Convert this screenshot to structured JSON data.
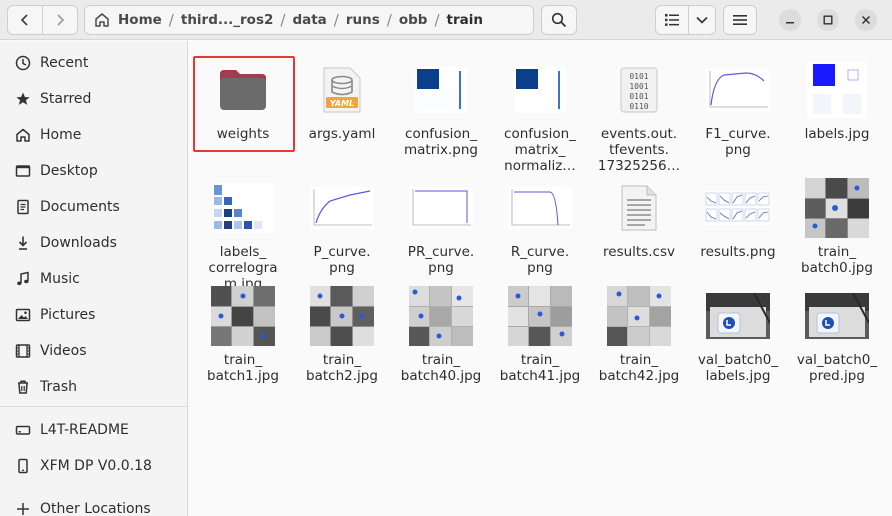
{
  "header": {
    "breadcrumbs": [
      "Home",
      "third..._ros2",
      "data",
      "runs",
      "obb",
      "train"
    ],
    "separator": "/"
  },
  "icons": {
    "back": "chevron-left-icon",
    "forward": "chevron-right-icon",
    "home": "home-icon",
    "path_menu": "vertical-dots-icon",
    "search": "search-icon",
    "view": "list-view-icon",
    "view_dropdown": "chevron-down-icon",
    "menu": "hamburger-menu-icon",
    "minimize": "minimize-icon",
    "maximize": "maximize-icon",
    "close": "close-icon"
  },
  "sidebar": {
    "items": [
      {
        "label": "Recent",
        "icon": "clock-icon"
      },
      {
        "label": "Starred",
        "icon": "star-icon"
      },
      {
        "label": "Home",
        "icon": "home-icon"
      },
      {
        "label": "Desktop",
        "icon": "desktop-icon"
      },
      {
        "label": "Documents",
        "icon": "document-icon"
      },
      {
        "label": "Downloads",
        "icon": "download-icon"
      },
      {
        "label": "Music",
        "icon": "music-icon"
      },
      {
        "label": "Pictures",
        "icon": "pictures-icon"
      },
      {
        "label": "Videos",
        "icon": "video-icon"
      },
      {
        "label": "Trash",
        "icon": "trash-icon"
      }
    ],
    "devices": [
      {
        "label": "L4T-README",
        "icon": "drive-icon"
      },
      {
        "label": "XFM DP V0.0.18",
        "icon": "phone-icon"
      },
      {
        "label": "Other Locations",
        "icon": "plus-icon"
      }
    ]
  },
  "files": [
    {
      "name": "weights",
      "kind": "folder"
    },
    {
      "name": "args.yaml",
      "kind": "yaml"
    },
    {
      "name": "confusion_\nmatrix.png",
      "kind": "matrix"
    },
    {
      "name": "confusion_\nmatrix_\nnormaliz…",
      "kind": "matrix"
    },
    {
      "name": "events.out.\ntfevents.\n17325256…",
      "kind": "binary"
    },
    {
      "name": "F1_curve.\npng",
      "kind": "curve"
    },
    {
      "name": "labels.jpg",
      "kind": "labels"
    },
    {
      "name": "labels_\ncorrelogra\nm.jpg",
      "kind": "correlogram"
    },
    {
      "name": "P_curve.\npng",
      "kind": "curve"
    },
    {
      "name": "PR_curve.\npng",
      "kind": "flatcurve"
    },
    {
      "name": "R_curve.\npng",
      "kind": "flatcurve"
    },
    {
      "name": "results.csv",
      "kind": "text"
    },
    {
      "name": "results.png",
      "kind": "results"
    },
    {
      "name": "train_\nbatch0.jpg",
      "kind": "photo"
    },
    {
      "name": "train_\nbatch1.jpg",
      "kind": "photo"
    },
    {
      "name": "train_\nbatch2.jpg",
      "kind": "photo"
    },
    {
      "name": "train_\nbatch40.jpg",
      "kind": "photo"
    },
    {
      "name": "train_\nbatch41.jpg",
      "kind": "photo"
    },
    {
      "name": "train_\nbatch42.jpg",
      "kind": "photo"
    },
    {
      "name": "val_batch0_\nlabels.jpg",
      "kind": "valphoto"
    },
    {
      "name": "val_batch0_\npred.jpg",
      "kind": "valphoto"
    }
  ],
  "yaml_badge": "YAML",
  "binary_glyph": [
    "0101",
    "1001",
    "0101",
    "0110"
  ],
  "colors": {
    "accent_selection": "#e53935",
    "folder": "#6b6b6b",
    "folder_tab": "#a33c4f",
    "matrix_blue": "#0b3f8c"
  }
}
